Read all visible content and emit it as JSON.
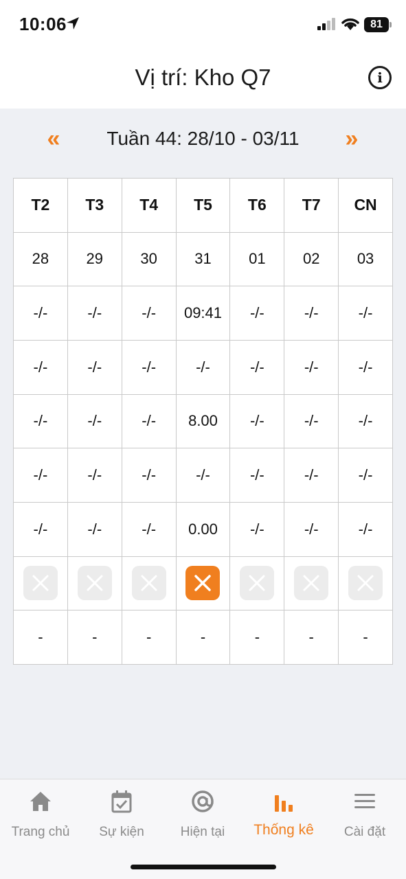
{
  "status_bar": {
    "time": "10:06",
    "battery": "81"
  },
  "header": {
    "title": "Vị trí: Kho Q7"
  },
  "week_nav": {
    "prev": "«",
    "label": "Tuần 44: 28/10 - 03/11",
    "next": "»"
  },
  "table": {
    "days": [
      "T2",
      "T3",
      "T4",
      "T5",
      "T6",
      "T7",
      "CN"
    ],
    "rows": [
      [
        "28",
        "29",
        "30",
        "31",
        "01",
        "02",
        "03"
      ],
      [
        "-/-",
        "-/-",
        "-/-",
        "09:41",
        "-/-",
        "-/-",
        "-/-"
      ],
      [
        "-/-",
        "-/-",
        "-/-",
        "-/-",
        "-/-",
        "-/-",
        "-/-"
      ],
      [
        "-/-",
        "-/-",
        "-/-",
        "8.00",
        "-/-",
        "-/-",
        "-/-"
      ],
      [
        "-/-",
        "-/-",
        "-/-",
        "-/-",
        "-/-",
        "-/-",
        "-/-"
      ],
      [
        "-/-",
        "-/-",
        "-/-",
        "0.00",
        "-/-",
        "-/-",
        "-/-"
      ]
    ],
    "status_active": [
      false,
      false,
      false,
      true,
      false,
      false,
      false
    ],
    "last_row": [
      "-",
      "-",
      "-",
      "-",
      "-",
      "-",
      "-"
    ]
  },
  "tabs": [
    {
      "id": "home",
      "label": "Trang chủ",
      "icon": "home-icon",
      "active": false
    },
    {
      "id": "events",
      "label": "Sự kiện",
      "icon": "calendar-check-icon",
      "active": false
    },
    {
      "id": "current",
      "label": "Hiện tại",
      "icon": "at-icon",
      "active": false
    },
    {
      "id": "stats",
      "label": "Thống kê",
      "icon": "bar-chart-icon",
      "active": true
    },
    {
      "id": "settings",
      "label": "Cài đặt",
      "icon": "menu-icon",
      "active": false
    }
  ],
  "colors": {
    "accent": "#f07f1f",
    "inactive": "#8a8a8a",
    "grid_line": "#c9c9c9",
    "background": "#eef0f4"
  }
}
